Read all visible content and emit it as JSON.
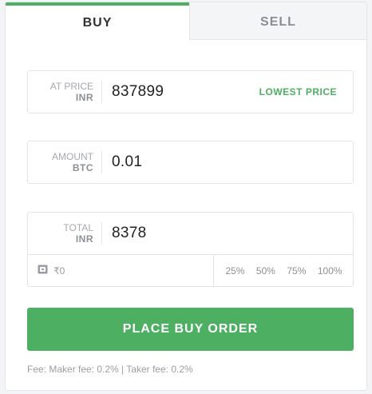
{
  "tabs": {
    "buy": "BUY",
    "sell": "SELL"
  },
  "price": {
    "label1": "AT PRICE",
    "label2": "INR",
    "value": "837899",
    "lowest": "LOWEST PRICE"
  },
  "amount": {
    "label1": "AMOUNT",
    "label2": "BTC",
    "value": "0.01"
  },
  "total": {
    "label1": "TOTAL",
    "label2": "INR",
    "value": "8378",
    "wallet_balance": "₹0",
    "percentages": [
      "25%",
      "50%",
      "75%",
      "100%"
    ]
  },
  "order_button": "PLACE BUY ORDER",
  "fee_text": "Fee: Maker fee: 0.2% | Taker fee: 0.2%",
  "colors": {
    "accent": "#4caf61",
    "border": "#e2e4e7",
    "muted": "#a5a8ad"
  },
  "icons": {
    "wallet": "wallet-icon"
  }
}
